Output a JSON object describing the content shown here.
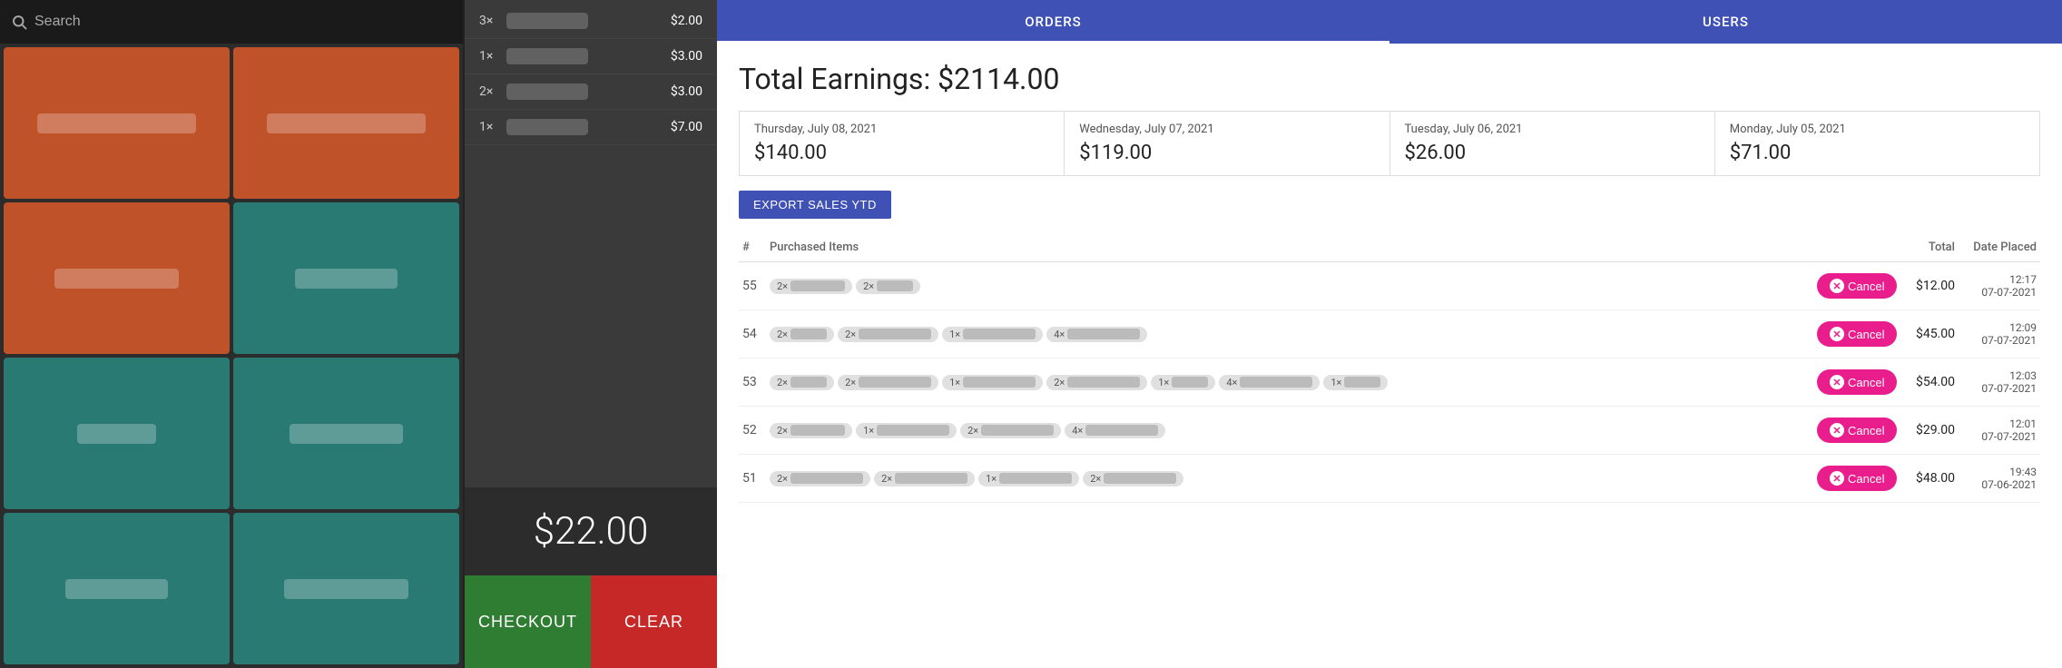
{
  "pos": {
    "search_placeholder": "Search",
    "grid_items": [
      {
        "color": "orange"
      },
      {
        "color": "orange"
      },
      {
        "color": "orange"
      },
      {
        "color": "teal"
      },
      {
        "color": "teal"
      },
      {
        "color": "teal"
      },
      {
        "color": "teal"
      },
      {
        "color": "teal"
      }
    ]
  },
  "cart": {
    "items": [
      {
        "qty": "3×",
        "price": "$2.00"
      },
      {
        "qty": "1×",
        "price": "$3.00"
      },
      {
        "qty": "2×",
        "price": "$3.00"
      },
      {
        "qty": "1×",
        "price": "$7.00"
      }
    ],
    "total": "$22.00",
    "checkout_label": "CHECKOUT",
    "clear_label": "CLEAR"
  },
  "orders": {
    "tabs": [
      {
        "label": "ORDERS",
        "active": true
      },
      {
        "label": "USERS",
        "active": false
      }
    ],
    "total_earnings_label": "Total Earnings: $2114.00",
    "date_cards": [
      {
        "date": "Thursday, July 08, 2021",
        "amount": "$140.00"
      },
      {
        "date": "Wednesday, July 07, 2021",
        "amount": "$119.00"
      },
      {
        "date": "Tuesday, July 06, 2021",
        "amount": "$26.00"
      },
      {
        "date": "Monday, July 05, 2021",
        "amount": "$71.00"
      }
    ],
    "export_label": "EXPORT SALES YTD",
    "table_headers": {
      "num": "#",
      "items": "Purchased Items",
      "total": "Total",
      "date": "Date Placed"
    },
    "orders_list": [
      {
        "num": "55",
        "items": [
          {
            "qty": "2×",
            "wide": false
          },
          {
            "qty": "2×",
            "wide": false,
            "short": true
          }
        ],
        "total": "$12.00",
        "time": "12:17",
        "date": "07-07-2021"
      },
      {
        "num": "54",
        "items": [
          {
            "qty": "2×",
            "wide": false,
            "short": true
          },
          {
            "qty": "2×",
            "wide": true
          },
          {
            "qty": "1×",
            "wide": true
          },
          {
            "qty": "4×",
            "wide": true
          }
        ],
        "total": "$45.00",
        "time": "12:09",
        "date": "07-07-2021"
      },
      {
        "num": "53",
        "items": [
          {
            "qty": "2×",
            "wide": false,
            "short": true
          },
          {
            "qty": "2×",
            "wide": true
          },
          {
            "qty": "1×",
            "wide": true
          },
          {
            "qty": "2×",
            "wide": true
          },
          {
            "qty": "1×",
            "wide": false,
            "short": true
          },
          {
            "qty": "4×",
            "wide": true
          },
          {
            "qty": "1×",
            "wide": false,
            "short": true
          }
        ],
        "total": "$54.00",
        "time": "12:03",
        "date": "07-07-2021"
      },
      {
        "num": "52",
        "items": [
          {
            "qty": "2×",
            "wide": false
          },
          {
            "qty": "1×",
            "wide": true
          },
          {
            "qty": "2×",
            "wide": true
          },
          {
            "qty": "4×",
            "wide": true
          }
        ],
        "total": "$29.00",
        "time": "12:01",
        "date": "07-07-2021"
      },
      {
        "num": "51",
        "items": [
          {
            "qty": "2×",
            "wide": true
          },
          {
            "qty": "2×",
            "wide": true
          },
          {
            "qty": "1×",
            "wide": true
          },
          {
            "qty": "2×",
            "wide": true
          }
        ],
        "total": "$48.00",
        "time": "19:43",
        "date": "07-06-2021"
      }
    ],
    "cancel_label": "Cancel"
  }
}
